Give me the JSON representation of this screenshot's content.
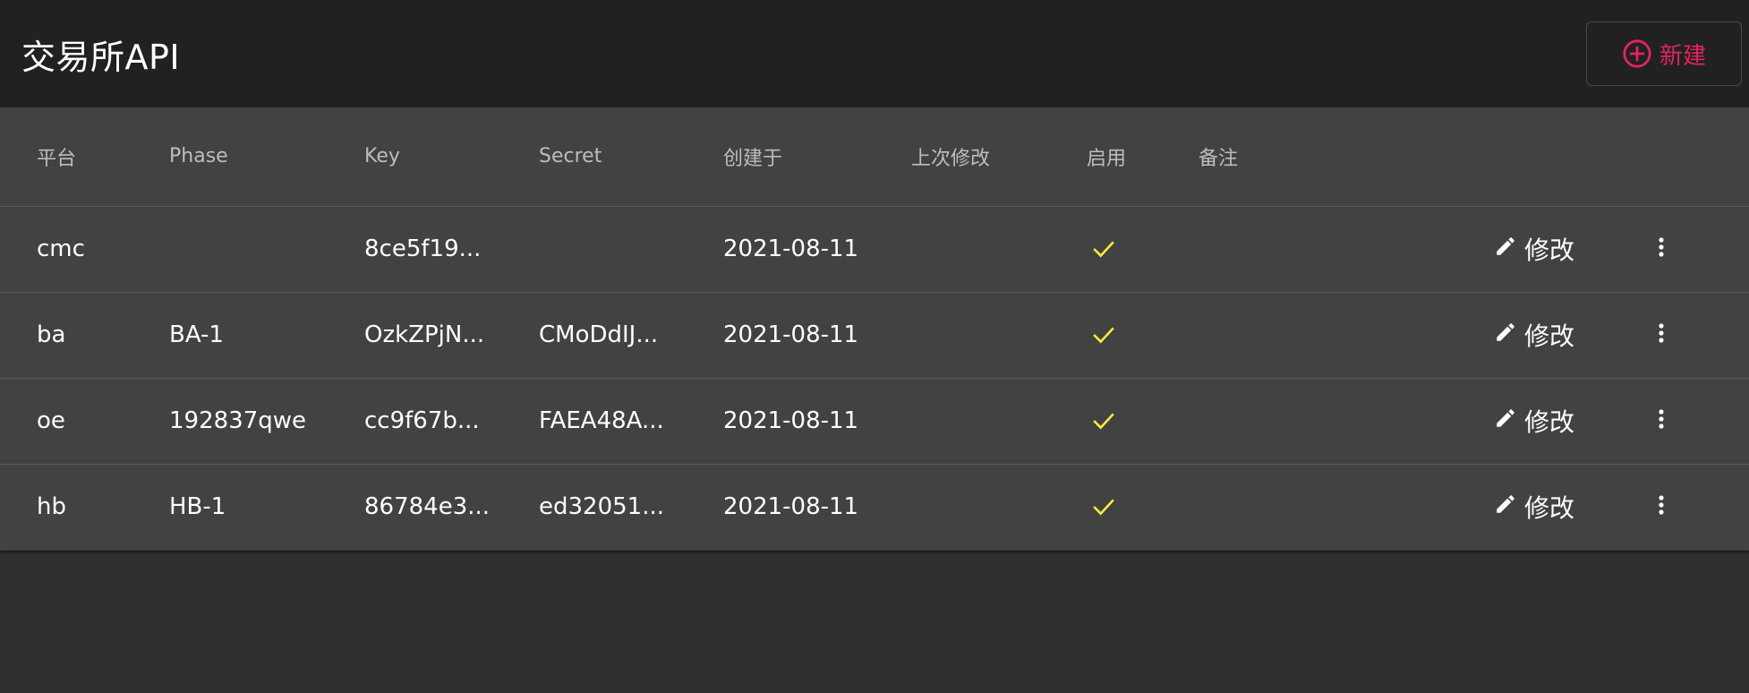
{
  "header": {
    "title": "交易所API",
    "new_button_label": "新建"
  },
  "colors": {
    "accent": "#e0245e",
    "check": "#ffeb3b",
    "header_bg": "#212121",
    "table_bg": "#424242",
    "page_bg": "#2f2f2f"
  },
  "table": {
    "columns": [
      "平台",
      "Phase",
      "Key",
      "Secret",
      "创建于",
      "上次修改",
      "启用",
      "备注"
    ],
    "edit_label": "修改",
    "rows": [
      {
        "platform": "cmc",
        "phase": "",
        "key": "8ce5f19...",
        "secret": "",
        "created": "2021-08-11",
        "modified": "",
        "enabled": true,
        "note": ""
      },
      {
        "platform": "ba",
        "phase": "BA-1",
        "key": "OzkZPjN...",
        "secret": "CMoDdIJ...",
        "created": "2021-08-11",
        "modified": "",
        "enabled": true,
        "note": ""
      },
      {
        "platform": "oe",
        "phase": "192837qwe",
        "key": "cc9f67b...",
        "secret": "FAEA48A...",
        "created": "2021-08-11",
        "modified": "",
        "enabled": true,
        "note": ""
      },
      {
        "platform": "hb",
        "phase": "HB-1",
        "key": "86784e3...",
        "secret": "ed32051...",
        "created": "2021-08-11",
        "modified": "",
        "enabled": true,
        "note": ""
      }
    ]
  },
  "icons": {
    "new": "plus-circle-icon",
    "edit": "pencil-icon",
    "more": "more-vertical-icon",
    "enabled": "check-icon"
  }
}
